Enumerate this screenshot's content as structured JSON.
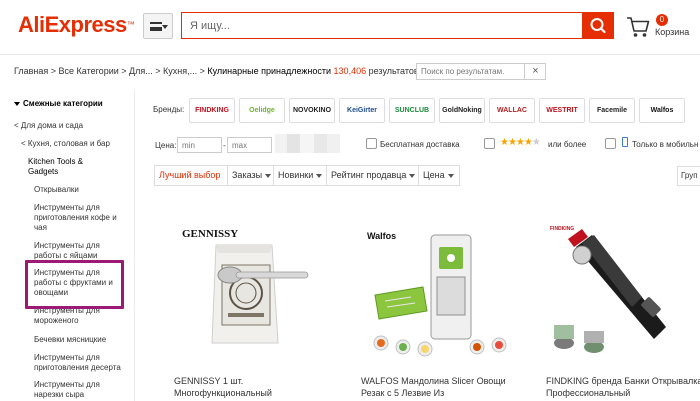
{
  "header": {
    "logo": "AliExpress",
    "search_placeholder": "Я ищу...",
    "cart_count": "0",
    "cart_label": "Корзина"
  },
  "breadcrumb": {
    "path": "Главная > Все Категории > Для... > Кухня,... > ",
    "current": "Кулинарные принадлежности",
    "count": "130,406",
    "results_label": "результатов >"
  },
  "refine": {
    "placeholder": "Поиск по результатам.",
    "clear": "×"
  },
  "sidebar": {
    "title": "Смежные категории",
    "items": [
      "< Для дома и сада",
      "< Кухня, столовая и бар",
      "Kitchen Tools & Gadgets",
      "Открывалки",
      "Инструменты для приготовления кофе и чая",
      "Инструменты для работы с яйцами",
      "Инструменты для работы с фруктами и овощами",
      "Инструменты для мороженого",
      "Бечевки мясницкие",
      "Инструменты для приготовления десерта",
      "Инструменты для нарезки сыра"
    ]
  },
  "brands": {
    "label": "Бренды:",
    "items": [
      {
        "name": "FINDKING",
        "color": "#c0121e"
      },
      {
        "name": "Oelidge",
        "color": "#6bb52e"
      },
      {
        "name": "NOVOKINO",
        "color": "#222222"
      },
      {
        "name": "KeiGirter",
        "color": "#1a4d8f"
      },
      {
        "name": "SUNCLUB",
        "color": "#1a8a3a"
      },
      {
        "name": "GoldNoking",
        "color": "#222222"
      },
      {
        "name": "WALLAC",
        "color": "#b22222"
      },
      {
        "name": "WESTRIT",
        "color": "#c0121e"
      },
      {
        "name": "Facemile",
        "color": "#222222"
      },
      {
        "name": "Walfos",
        "color": "#111111"
      }
    ]
  },
  "filters": {
    "price_label": "Цена:",
    "min_placeholder": "min",
    "max_placeholder": "max",
    "free_shipping": "Бесплатная доставка",
    "rating_stars": "★★★★",
    "rating_off": "★",
    "rating_suffix": "или более",
    "mobile_only": "Только в мобильн"
  },
  "sort": {
    "best": "Лучший выбор",
    "orders": "Заказы",
    "newest": "Новинки",
    "seller_rating": "Рейтинг продавца",
    "price": "Цена",
    "group": "Груп"
  },
  "products": [
    {
      "brand": "GENNISSY",
      "title": "GENNISSY 1 шт. Многофункциональный"
    },
    {
      "brand": "Walfos",
      "title": "WALFOS Мандолина Slicer Овощи Резак с 5 Лезвие Из"
    },
    {
      "brand": "FINDKING",
      "title": "FINDKING бренда Банки Открывалка Профессиональный"
    }
  ],
  "colors": {
    "accent": "#e62e04",
    "highlight": "#9b1a76",
    "star": "#f7a600"
  }
}
